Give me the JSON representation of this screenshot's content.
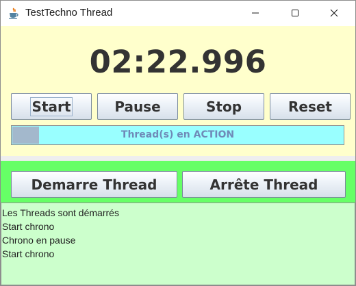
{
  "window": {
    "title": "TestTechno Thread",
    "icons": {
      "app": "java-cup-icon",
      "minimize": "minimize-icon",
      "maximize": "maximize-icon",
      "close": "close-icon"
    }
  },
  "timer": {
    "display": "02:22.996"
  },
  "controls": {
    "start_label": "Start",
    "pause_label": "Pause",
    "stop_label": "Stop",
    "reset_label": "Reset"
  },
  "progress": {
    "label": "Thread(s) en ACTION",
    "value_percent": 8
  },
  "thread_controls": {
    "demarre_label": "Demarre Thread",
    "arrete_label": "Arrête Thread"
  },
  "log": {
    "lines": [
      "Les Threads sont démarrés",
      "Start chrono",
      "Chrono en pause",
      "Start chrono"
    ]
  },
  "colors": {
    "top_panel_bg": "#ffffcc",
    "progress_bg": "#99ffff",
    "green_panel_bg": "#66ff66",
    "log_bg": "#ccffcc"
  }
}
